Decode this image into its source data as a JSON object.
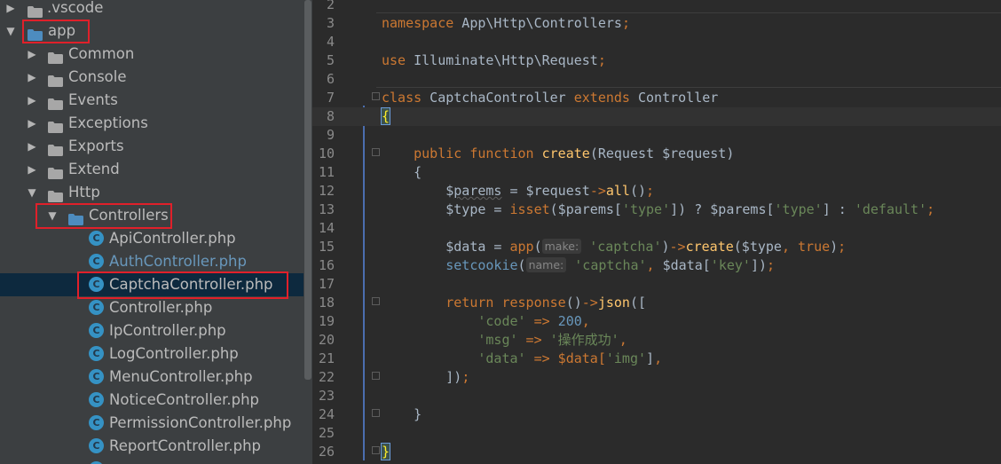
{
  "sidebar": {
    "items": [
      {
        "label": ".vscode",
        "kind": "folder",
        "expanded": false
      },
      {
        "label": "app",
        "kind": "folder",
        "expanded": true,
        "highlighted": true
      },
      {
        "label": "Common",
        "kind": "folder",
        "expanded": false
      },
      {
        "label": "Console",
        "kind": "folder",
        "expanded": false
      },
      {
        "label": "Events",
        "kind": "folder",
        "expanded": false
      },
      {
        "label": "Exceptions",
        "kind": "folder",
        "expanded": false
      },
      {
        "label": "Exports",
        "kind": "folder",
        "expanded": false
      },
      {
        "label": "Extend",
        "kind": "folder",
        "expanded": false
      },
      {
        "label": "Http",
        "kind": "folder",
        "expanded": true
      },
      {
        "label": "Controllers",
        "kind": "folder",
        "expanded": true,
        "highlighted": true
      },
      {
        "label": "ApiController.php",
        "kind": "class-file"
      },
      {
        "label": "AuthController.php",
        "kind": "class-file",
        "modified": true
      },
      {
        "label": "CaptchaController.php",
        "kind": "class-file",
        "selected": true,
        "highlighted": true
      },
      {
        "label": "Controller.php",
        "kind": "class-file"
      },
      {
        "label": "IpController.php",
        "kind": "class-file"
      },
      {
        "label": "LogController.php",
        "kind": "class-file"
      },
      {
        "label": "MenuController.php",
        "kind": "class-file"
      },
      {
        "label": "NoticeController.php",
        "kind": "class-file"
      },
      {
        "label": "PermissionController.php",
        "kind": "class-file"
      },
      {
        "label": "ReportController.php",
        "kind": "class-file"
      }
    ],
    "class_icon_letter": "C"
  },
  "editor": {
    "lines": [
      {
        "n": "2",
        "segs": []
      },
      {
        "n": "3",
        "segs": [
          {
            "t": "namespace",
            "c": "kw"
          },
          {
            "t": " App\\Http\\Controllers",
            "c": ""
          },
          {
            "t": ";",
            "c": "kw"
          }
        ]
      },
      {
        "n": "4",
        "segs": []
      },
      {
        "n": "5",
        "segs": [
          {
            "t": "use",
            "c": "kw"
          },
          {
            "t": " Illuminate\\Http\\Request",
            "c": ""
          },
          {
            "t": ";",
            "c": "kw"
          }
        ]
      },
      {
        "n": "6",
        "segs": []
      },
      {
        "n": "7",
        "segs": [
          {
            "t": "class",
            "c": "kw"
          },
          {
            "t": " CaptchaController ",
            "c": ""
          },
          {
            "t": "extends",
            "c": "kw"
          },
          {
            "t": " Controller",
            "c": ""
          }
        ]
      },
      {
        "n": "8",
        "segs": [
          {
            "t": "{",
            "c": "brace-hl"
          }
        ]
      },
      {
        "n": "9",
        "segs": []
      },
      {
        "n": "10",
        "segs": [
          {
            "t": "    ",
            "c": ""
          },
          {
            "t": "public function",
            "c": "kw"
          },
          {
            "t": " ",
            "c": ""
          },
          {
            "t": "create",
            "c": "fn"
          },
          {
            "t": "(Request $request)",
            "c": ""
          }
        ]
      },
      {
        "n": "11",
        "segs": [
          {
            "t": "    {",
            "c": ""
          }
        ]
      },
      {
        "n": "12",
        "segs": [
          {
            "t": "        $",
            "c": ""
          },
          {
            "t": "parems",
            "c": "wavy"
          },
          {
            "t": " = $request",
            "c": ""
          },
          {
            "t": "->",
            "c": "kw"
          },
          {
            "t": "all",
            "c": "fn"
          },
          {
            "t": "()",
            "c": ""
          },
          {
            "t": ";",
            "c": "kw"
          }
        ]
      },
      {
        "n": "13",
        "segs": [
          {
            "t": "        $type = ",
            "c": ""
          },
          {
            "t": "isset",
            "c": "kw"
          },
          {
            "t": "($parems[",
            "c": ""
          },
          {
            "t": "'type'",
            "c": "str"
          },
          {
            "t": "]) ? $parems[",
            "c": ""
          },
          {
            "t": "'type'",
            "c": "str"
          },
          {
            "t": "] : ",
            "c": ""
          },
          {
            "t": "'default'",
            "c": "str"
          },
          {
            "t": ";",
            "c": "kw"
          }
        ]
      },
      {
        "n": "14",
        "segs": []
      },
      {
        "n": "15",
        "segs": [
          {
            "t": "        $data = ",
            "c": ""
          },
          {
            "t": "app",
            "c": "kw"
          },
          {
            "t": "(",
            "c": ""
          },
          {
            "t": "make:",
            "c": "hint"
          },
          {
            "t": " ",
            "c": ""
          },
          {
            "t": "'captcha'",
            "c": "str"
          },
          {
            "t": ")",
            "c": ""
          },
          {
            "t": "->",
            "c": "kw"
          },
          {
            "t": "create",
            "c": "fn"
          },
          {
            "t": "($type",
            "c": ""
          },
          {
            "t": ",",
            "c": "kw"
          },
          {
            "t": " ",
            "c": ""
          },
          {
            "t": "true",
            "c": "kw"
          },
          {
            "t": ")",
            "c": ""
          },
          {
            "t": ";",
            "c": "kw"
          }
        ]
      },
      {
        "n": "16",
        "segs": [
          {
            "t": "        ",
            "c": ""
          },
          {
            "t": "setcookie",
            "c": "num"
          },
          {
            "t": "(",
            "c": ""
          },
          {
            "t": "name:",
            "c": "hint"
          },
          {
            "t": " ",
            "c": ""
          },
          {
            "t": "'captcha'",
            "c": "str"
          },
          {
            "t": ",",
            "c": "kw"
          },
          {
            "t": " $data[",
            "c": ""
          },
          {
            "t": "'key'",
            "c": "str"
          },
          {
            "t": "])",
            "c": ""
          },
          {
            "t": ";",
            "c": "kw"
          }
        ]
      },
      {
        "n": "17",
        "segs": []
      },
      {
        "n": "18",
        "segs": [
          {
            "t": "        ",
            "c": ""
          },
          {
            "t": "return",
            "c": "kw"
          },
          {
            "t": " ",
            "c": ""
          },
          {
            "t": "response",
            "c": "kw"
          },
          {
            "t": "()",
            "c": ""
          },
          {
            "t": "->",
            "c": "kw"
          },
          {
            "t": "json",
            "c": "fn"
          },
          {
            "t": "([",
            "c": ""
          }
        ]
      },
      {
        "n": "19",
        "segs": [
          {
            "t": "            ",
            "c": ""
          },
          {
            "t": "'code'",
            "c": "str"
          },
          {
            "t": " => ",
            "c": "kw"
          },
          {
            "t": "200",
            "c": "num"
          },
          {
            "t": ",",
            "c": "kw"
          }
        ]
      },
      {
        "n": "20",
        "segs": [
          {
            "t": "            ",
            "c": ""
          },
          {
            "t": "'msg'",
            "c": "str"
          },
          {
            "t": " => ",
            "c": "kw"
          },
          {
            "t": "'操作成功'",
            "c": "str"
          },
          {
            "t": ",",
            "c": "kw"
          }
        ]
      },
      {
        "n": "21",
        "segs": [
          {
            "t": "            ",
            "c": ""
          },
          {
            "t": "'data'",
            "c": "str"
          },
          {
            "t": " => $data[",
            "c": "kw"
          },
          {
            "t": "'img'",
            "c": "str"
          },
          {
            "t": "]",
            "c": ""
          },
          {
            "t": ",",
            "c": "kw"
          }
        ]
      },
      {
        "n": "22",
        "segs": [
          {
            "t": "        ])",
            "c": ""
          },
          {
            "t": ";",
            "c": "kw"
          }
        ]
      },
      {
        "n": "23",
        "segs": []
      },
      {
        "n": "24",
        "segs": [
          {
            "t": "    }",
            "c": ""
          }
        ]
      },
      {
        "n": "25",
        "segs": []
      },
      {
        "n": "26",
        "segs": [
          {
            "t": "}",
            "c": "brace-hl"
          }
        ]
      }
    ]
  },
  "colors": {
    "sidebar_bg": "#3c3f41",
    "editor_bg": "#2b2b2b",
    "keyword": "#cc7832",
    "string": "#6a8759",
    "function": "#ffc66d",
    "number": "#6897bb",
    "selection": "#0d293e",
    "annotation_box": "#e0202a",
    "modified_file": "#6897bb"
  }
}
